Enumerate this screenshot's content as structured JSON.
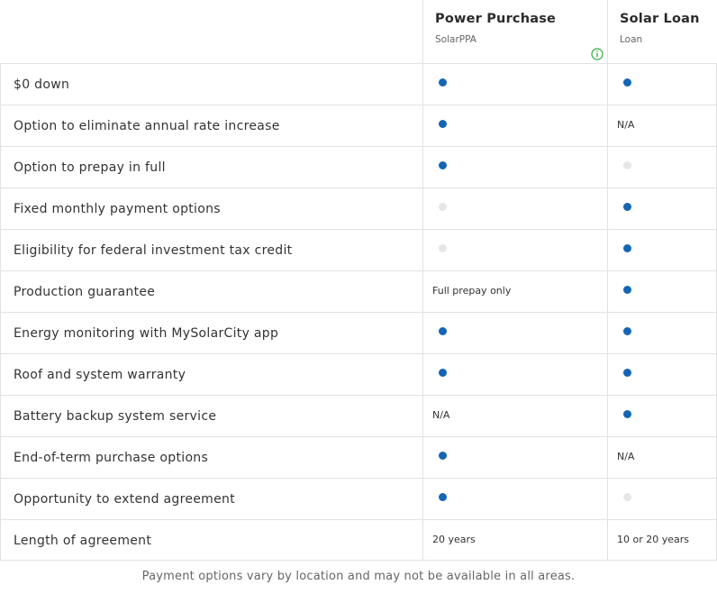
{
  "plans": [
    {
      "title": "Power Purchase",
      "subtitle": "SolarPPA"
    },
    {
      "title": "Solar Loan",
      "subtitle": "Loan"
    }
  ],
  "colors": {
    "available": "#1565b5",
    "unavailable": "#e6e6e6",
    "info_icon": "#2eaa3e"
  },
  "rows": [
    {
      "feature": "$0 down",
      "ppa": {
        "type": "dot",
        "available": true
      },
      "loan": {
        "type": "dot",
        "available": true
      }
    },
    {
      "feature": "Option to eliminate annual rate increase",
      "ppa": {
        "type": "dot",
        "available": true
      },
      "loan": {
        "type": "text",
        "text": "N/A"
      }
    },
    {
      "feature": "Option to prepay in full",
      "ppa": {
        "type": "dot",
        "available": true
      },
      "loan": {
        "type": "dot",
        "available": false
      }
    },
    {
      "feature": "Fixed monthly payment options",
      "ppa": {
        "type": "dot",
        "available": false
      },
      "loan": {
        "type": "dot",
        "available": true
      }
    },
    {
      "feature": "Eligibility for federal investment tax credit",
      "ppa": {
        "type": "dot",
        "available": false
      },
      "loan": {
        "type": "dot",
        "available": true
      }
    },
    {
      "feature": "Production guarantee",
      "ppa": {
        "type": "text",
        "text": "Full prepay only"
      },
      "loan": {
        "type": "dot",
        "available": true
      }
    },
    {
      "feature": "Energy monitoring with MySolarCity app",
      "ppa": {
        "type": "dot",
        "available": true
      },
      "loan": {
        "type": "dot",
        "available": true
      }
    },
    {
      "feature": "Roof and system warranty",
      "ppa": {
        "type": "dot",
        "available": true
      },
      "loan": {
        "type": "dot",
        "available": true
      }
    },
    {
      "feature": "Battery backup system service",
      "ppa": {
        "type": "text",
        "text": "N/A"
      },
      "loan": {
        "type": "dot",
        "available": true
      }
    },
    {
      "feature": "End-of-term purchase options",
      "ppa": {
        "type": "dot",
        "available": true
      },
      "loan": {
        "type": "text",
        "text": "N/A"
      }
    },
    {
      "feature": "Opportunity to extend agreement",
      "ppa": {
        "type": "dot",
        "available": true
      },
      "loan": {
        "type": "dot",
        "available": false
      }
    },
    {
      "feature": "Length of agreement",
      "ppa": {
        "type": "text",
        "text": "20 years"
      },
      "loan": {
        "type": "text",
        "text": "10 or 20 years"
      }
    }
  ],
  "footnote": "Payment options vary by location and may not be available in all areas."
}
